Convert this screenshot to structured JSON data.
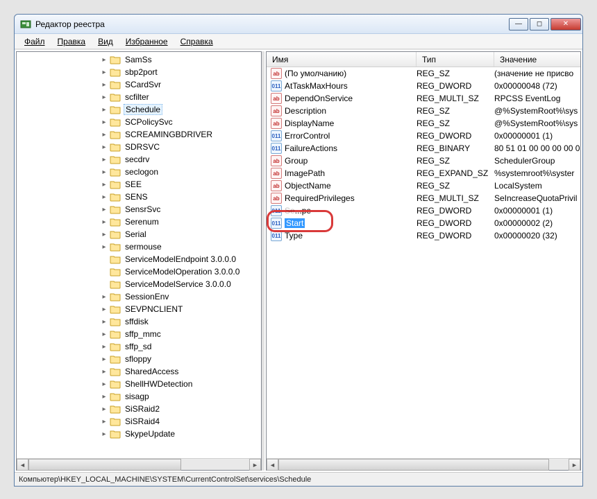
{
  "window": {
    "title": "Редактор реестра"
  },
  "menu": {
    "file": "Файл",
    "edit": "Правка",
    "view": "Вид",
    "favorites": "Избранное",
    "help": "Справка"
  },
  "tree": {
    "items": [
      {
        "label": "SamSs",
        "exp": true
      },
      {
        "label": "sbp2port",
        "exp": true
      },
      {
        "label": "SCardSvr",
        "exp": true
      },
      {
        "label": "scfilter",
        "exp": true
      },
      {
        "label": "Schedule",
        "exp": true,
        "selected": true
      },
      {
        "label": "SCPolicySvc",
        "exp": true
      },
      {
        "label": "SCREAMINGBDRIVER",
        "exp": true
      },
      {
        "label": "SDRSVC",
        "exp": true
      },
      {
        "label": "secdrv",
        "exp": true
      },
      {
        "label": "seclogon",
        "exp": true
      },
      {
        "label": "SEE",
        "exp": true
      },
      {
        "label": "SENS",
        "exp": true
      },
      {
        "label": "SensrSvc",
        "exp": true
      },
      {
        "label": "Serenum",
        "exp": true
      },
      {
        "label": "Serial",
        "exp": true
      },
      {
        "label": "sermouse",
        "exp": true
      },
      {
        "label": "ServiceModelEndpoint 3.0.0.0",
        "exp": false
      },
      {
        "label": "ServiceModelOperation 3.0.0.0",
        "exp": false
      },
      {
        "label": "ServiceModelService 3.0.0.0",
        "exp": false
      },
      {
        "label": "SessionEnv",
        "exp": true
      },
      {
        "label": "SEVPNCLIENT",
        "exp": true
      },
      {
        "label": "sffdisk",
        "exp": true
      },
      {
        "label": "sffp_mmc",
        "exp": true
      },
      {
        "label": "sffp_sd",
        "exp": true
      },
      {
        "label": "sfloppy",
        "exp": true
      },
      {
        "label": "SharedAccess",
        "exp": true
      },
      {
        "label": "ShellHWDetection",
        "exp": true
      },
      {
        "label": "sisagp",
        "exp": true
      },
      {
        "label": "SiSRaid2",
        "exp": true
      },
      {
        "label": "SiSRaid4",
        "exp": true
      },
      {
        "label": "SkypeUpdate",
        "exp": true
      }
    ]
  },
  "list": {
    "columns": {
      "name": "Имя",
      "type": "Тип",
      "value": "Значение"
    },
    "rows": [
      {
        "kind": "ab",
        "name": "(По умолчанию)",
        "type": "REG_SZ",
        "value": "(значение не присво"
      },
      {
        "kind": "bn",
        "name": "AtTaskMaxHours",
        "type": "REG_DWORD",
        "value": "0x00000048 (72)"
      },
      {
        "kind": "ab",
        "name": "DependOnService",
        "type": "REG_MULTI_SZ",
        "value": "RPCSS EventLog"
      },
      {
        "kind": "ab",
        "name": "Description",
        "type": "REG_SZ",
        "value": "@%SystemRoot%\\sys"
      },
      {
        "kind": "ab",
        "name": "DisplayName",
        "type": "REG_SZ",
        "value": "@%SystemRoot%\\sys"
      },
      {
        "kind": "bn",
        "name": "ErrorControl",
        "type": "REG_DWORD",
        "value": "0x00000001 (1)"
      },
      {
        "kind": "bn",
        "name": "FailureActions",
        "type": "REG_BINARY",
        "value": "80 51 01 00 00 00 00 0"
      },
      {
        "kind": "ab",
        "name": "Group",
        "type": "REG_SZ",
        "value": "SchedulerGroup"
      },
      {
        "kind": "ab",
        "name": "ImagePath",
        "type": "REG_EXPAND_SZ",
        "value": "%systemroot%\\syster"
      },
      {
        "kind": "ab",
        "name": "ObjectName",
        "type": "REG_SZ",
        "value": "LocalSystem"
      },
      {
        "kind": "ab",
        "name": "RequiredPrivileges",
        "type": "REG_MULTI_SZ",
        "value": "SeIncreaseQuotaPrivil"
      },
      {
        "kind": "bn",
        "name": "ServiceSidType",
        "type": "REG_DWORD",
        "value": "0x00000001 (1)",
        "obscured": true
      },
      {
        "kind": "bn",
        "name": "Start",
        "type": "REG_DWORD",
        "value": "0x00000002 (2)",
        "selected": true
      },
      {
        "kind": "bn",
        "name": "Type",
        "type": "REG_DWORD",
        "value": "0x00000020 (32)"
      }
    ]
  },
  "statusbar": {
    "path": "Компьютер\\HKEY_LOCAL_MACHINE\\SYSTEM\\CurrentControlSet\\services\\Schedule"
  },
  "icons": {
    "ab_text": "ab",
    "bn_text": "011"
  }
}
